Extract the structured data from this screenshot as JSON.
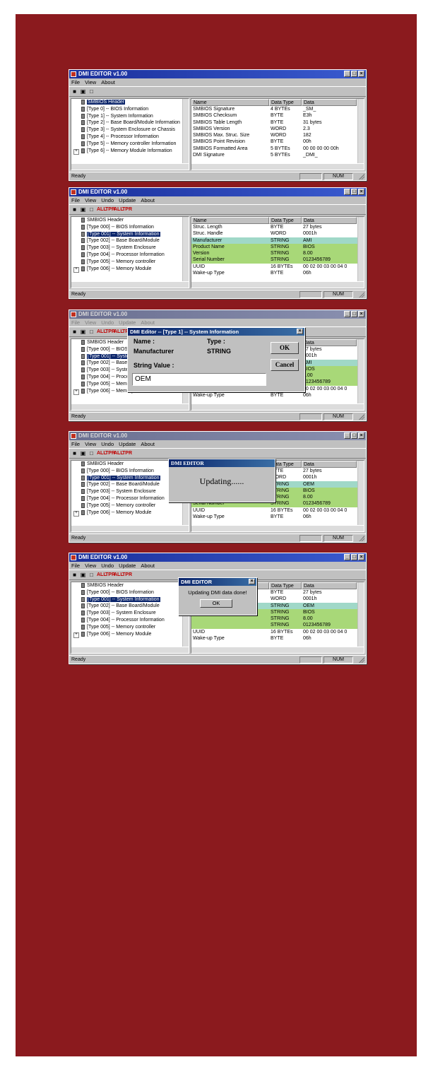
{
  "background_color": "#8b1a1e",
  "screens": [
    {
      "title": "DMI EDITOR v1.00",
      "menu": [
        "File",
        "View",
        "About"
      ],
      "toolbar": [
        "save-icon",
        "open-icon",
        "page-icon"
      ],
      "tree": [
        {
          "label": "SMBIOS Header",
          "selected": true
        },
        {
          "label": "[Type  0] -- BIOS Information"
        },
        {
          "label": "[Type  1] -- System Information"
        },
        {
          "label": "[Type  2] -- Base Board/Module Information"
        },
        {
          "label": "[Type  3] -- System Enclosure or Chassis"
        },
        {
          "label": "[Type  4] -- Processor Information"
        },
        {
          "label": "[Type  5] -- Memory controller Information"
        },
        {
          "label": "[Type  6] -- Memory Module Information",
          "expandable": true
        }
      ],
      "columns": [
        "Name",
        "Data Type",
        "Data"
      ],
      "rows": [
        [
          "SMBIOS Signature",
          "4 BYTEs",
          "_SM_"
        ],
        [
          "SMBIOS Checksum",
          "BYTE",
          "E3h"
        ],
        [
          "SMBIOS Table Length",
          "BYTE",
          "31 bytes"
        ],
        [
          "SMBIOS Version",
          "WORD",
          "2.3"
        ],
        [
          "SMBIOS Max. Struc. Size",
          "WORD",
          "182"
        ],
        [
          "SMBIOS Point Revision",
          "BYTE",
          "00h"
        ],
        [
          "SMBIOS Formatted Area",
          "5 BYTEs",
          "00 00 00 00 00h"
        ],
        [
          "DMI Signature",
          "5 BYTEs",
          "_DMI_"
        ]
      ],
      "status": "Ready",
      "num": "NUM"
    },
    {
      "title": "DMI EDITOR v1.00",
      "menu": [
        "File",
        "View",
        "Undo",
        "Update",
        "About"
      ],
      "toolbar": [
        "save-icon",
        "open-icon",
        "page-icon",
        "ALL",
        "TPR",
        "ALL",
        "TPR"
      ],
      "tree": [
        {
          "label": "SMBIOS Header"
        },
        {
          "label": "[Type 000] -- BIOS Information"
        },
        {
          "label": "[Type 001] -- System Information",
          "selected": true
        },
        {
          "label": "[Type 002] -- Base Board/Module"
        },
        {
          "label": "[Type 003] -- System Enclosure"
        },
        {
          "label": "[Type 004] -- Processor Information"
        },
        {
          "label": "[Type 005] -- Memory controller"
        },
        {
          "label": "[Type 006] -- Memory Module",
          "expandable": true
        }
      ],
      "columns": [
        "Name",
        "Data Type",
        "Data"
      ],
      "rows": [
        [
          "Struc. Length",
          "BYTE",
          "27 bytes"
        ],
        [
          "Struc. Handle",
          "WORD",
          "0001h"
        ],
        [
          "Manufacturer",
          "STRING",
          "AMI",
          "hl2"
        ],
        [
          "Product Name",
          "STRING",
          "BIOS",
          "hl"
        ],
        [
          "Version",
          "STRING",
          "8.00",
          "hl"
        ],
        [
          "Serial Number",
          "STRING",
          "0123456789",
          "hl"
        ],
        [
          "UUID",
          "16 BYTEs",
          "00 02 00 03 00 04 0"
        ],
        [
          "Wake-up Type",
          "BYTE",
          "06h"
        ]
      ],
      "status": "Ready",
      "num": "NUM"
    },
    {
      "title": "DMI EDITOR v1.00",
      "menu": [
        "File",
        "View",
        "Undo",
        "Update",
        "About"
      ],
      "toolbar": [
        "save-icon",
        "open-icon",
        "page-icon",
        "ALL",
        "TPR",
        "ALL",
        "TPR"
      ],
      "tree": [
        {
          "label": "SMBIOS Header"
        },
        {
          "label": "[Type 000] -- BIOS Information"
        },
        {
          "label": "[Type 001] -- System Information",
          "selected": true
        },
        {
          "label": "[Type 002] -- Base Board/Module"
        },
        {
          "label": "[Type 003] -- System Enclosure"
        },
        {
          "label": "[Type 004] -- Processor Information"
        },
        {
          "label": "[Type 005] -- Memory controller"
        },
        {
          "label": "[Type 006] -- Memory Module",
          "expandable": true
        }
      ],
      "columns": [
        "Name",
        "Data Type",
        "Data"
      ],
      "rows": [
        [
          "",
          "",
          "27 bytes"
        ],
        [
          "",
          "",
          "0001h"
        ],
        [
          "",
          "",
          "AMI",
          "hl2"
        ],
        [
          "",
          "",
          "BIOS",
          "hl"
        ],
        [
          "",
          "",
          "8.00",
          "hl"
        ],
        [
          "",
          "",
          "0123456789",
          "hl"
        ],
        [
          "",
          "",
          "00 02 00 03 00 04 0"
        ],
        [
          "Wake-up Type",
          "BYTE",
          "06h"
        ]
      ],
      "status": "Ready",
      "num": "NUM",
      "edit_dialog": {
        "title": "DMI Editor -- [Type   1] -- System Information",
        "name_label": "Name :",
        "type_label": "Type :",
        "name_value": "Manufacturer",
        "type_value": "STRING",
        "string_label": "String Value :",
        "string_value": "OEM",
        "ok": "OK",
        "cancel": "Cancel"
      }
    },
    {
      "title": "DMI EDITOR v1.00",
      "menu": [
        "File",
        "View",
        "Undo",
        "Update",
        "About"
      ],
      "toolbar": [
        "save-icon",
        "open-icon",
        "page-icon",
        "ALL",
        "TPR",
        "ALL",
        "TPR"
      ],
      "tree": [
        {
          "label": "SMBIOS Header"
        },
        {
          "label": "[Type 000] -- BIOS Information"
        },
        {
          "label": "[Type 001] -- System Information",
          "selected": true
        },
        {
          "label": "[Type 002] -- Base Board/Module"
        },
        {
          "label": "[Type 003] -- System Enclosure"
        },
        {
          "label": "[Type 004] -- Processor Information"
        },
        {
          "label": "[Type 005] -- Memory controller"
        },
        {
          "label": "[Type 006] -- Memory Module",
          "expandable": true
        }
      ],
      "columns": [
        "Name",
        "Data Type",
        "Data"
      ],
      "rows": [
        [
          "",
          "BYTE",
          "27 bytes"
        ],
        [
          "",
          "WORD",
          "0001h"
        ],
        [
          "",
          "STRING",
          "OEM",
          "hl2"
        ],
        [
          "",
          "STRING",
          "BIOS",
          "hl"
        ],
        [
          "",
          "STRING",
          "8.00",
          "hl"
        ],
        [
          "Serial Number",
          "STRING",
          "0123456789",
          "hl"
        ],
        [
          "UUID",
          "16 BYTEs",
          "00 02 00 03 00 04 0"
        ],
        [
          "Wake-up Type",
          "BYTE",
          "06h"
        ]
      ],
      "status": "Ready",
      "num": "NUM",
      "progress_dialog": {
        "title": "DMI EDITOR",
        "message": "Updating......"
      }
    },
    {
      "title": "DMI EDITOR v1.00",
      "menu": [
        "File",
        "View",
        "Undo",
        "Update",
        "About"
      ],
      "toolbar": [
        "save-icon",
        "open-icon",
        "page-icon",
        "ALL",
        "TPR",
        "ALL",
        "TPR"
      ],
      "tree": [
        {
          "label": "SMBIOS Header"
        },
        {
          "label": "[Type 000] -- BIOS Information"
        },
        {
          "label": "[Type 001] -- System Information",
          "selected": true
        },
        {
          "label": "[Type 002] -- Base Board/Module"
        },
        {
          "label": "[Type 003] -- System Enclosure"
        },
        {
          "label": "[Type 004] -- Processor Information"
        },
        {
          "label": "[Type 005] -- Memory controller"
        },
        {
          "label": "[Type 006] -- Memory Module",
          "expandable": true
        }
      ],
      "columns": [
        "Name",
        "Data Type",
        "Data"
      ],
      "rows": [
        [
          "",
          "BYTE",
          "27 bytes"
        ],
        [
          "",
          "WORD",
          "0001h"
        ],
        [
          "",
          "STRING",
          "OEM",
          "hl2"
        ],
        [
          "",
          "STRING",
          "BIOS",
          "hl"
        ],
        [
          "",
          "STRING",
          "8.00",
          "hl"
        ],
        [
          "",
          "STRING",
          "0123456789",
          "hl"
        ],
        [
          "UUID",
          "16 BYTEs",
          "00 02 00 03 00 04 0"
        ],
        [
          "Wake-up Type",
          "BYTE",
          "06h"
        ]
      ],
      "status": "Ready",
      "num": "NUM",
      "done_dialog": {
        "title": "DMI EDITOR",
        "message": "Updating DMI data done!",
        "ok": "OK"
      }
    }
  ]
}
